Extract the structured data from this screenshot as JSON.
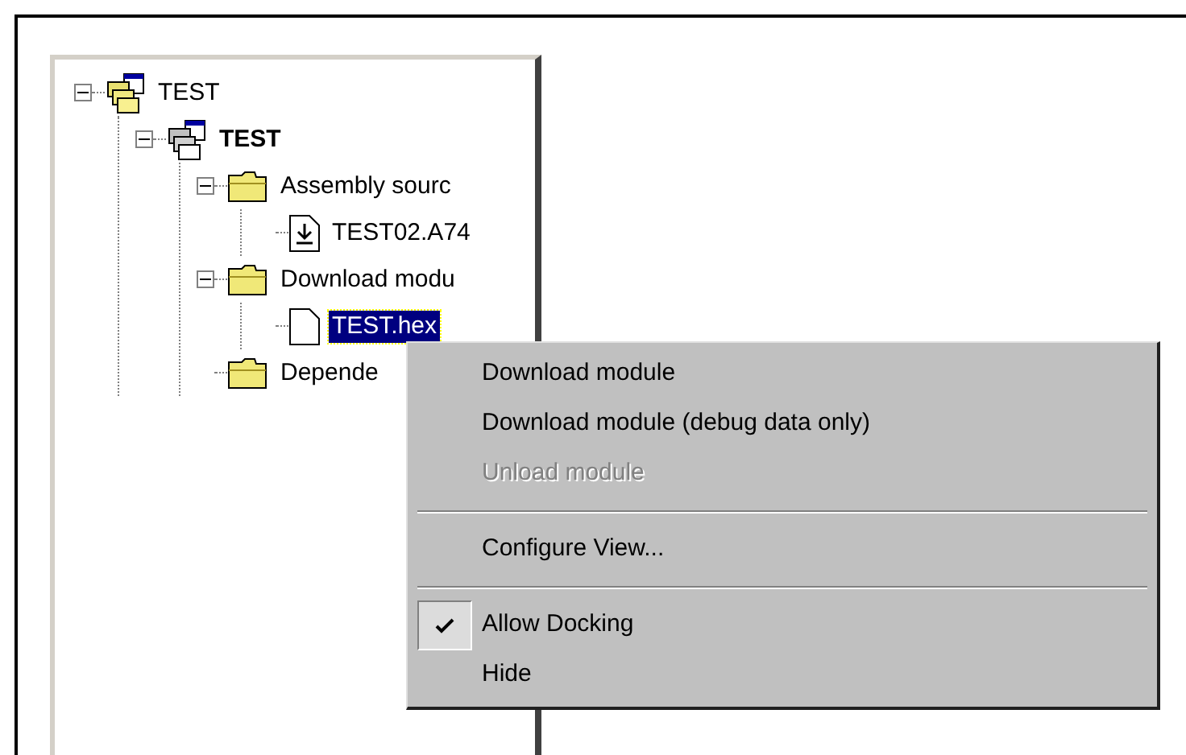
{
  "tree": [
    {
      "label": "TEST",
      "kind": "workspace",
      "expanded": true,
      "selected": false,
      "children": [
        {
          "label": "TEST",
          "kind": "project",
          "expanded": true,
          "selected": false,
          "children": [
            {
              "label": "Assembly sourc",
              "kind": "folder",
              "expanded": true,
              "selected": false,
              "children": [
                {
                  "label": "TEST02.A74",
                  "kind": "source",
                  "selected": false
                }
              ]
            },
            {
              "label": "Download modu",
              "kind": "folder",
              "expanded": true,
              "selected": false,
              "children": [
                {
                  "label": "TEST.hex",
                  "kind": "file",
                  "selected": true
                }
              ]
            },
            {
              "label": "Depende",
              "kind": "folder",
              "selected": false
            }
          ]
        }
      ]
    }
  ],
  "context_menu": [
    {
      "kind": "item",
      "label": "Download module",
      "disabled": false,
      "checked": false
    },
    {
      "kind": "item",
      "label": "Download module (debug data only)",
      "disabled": false,
      "checked": false
    },
    {
      "kind": "item",
      "label": "Unload module",
      "disabled": true,
      "checked": false
    },
    {
      "kind": "separator"
    },
    {
      "kind": "item",
      "label": "Configure View...",
      "disabled": false,
      "checked": false
    },
    {
      "kind": "separator"
    },
    {
      "kind": "item",
      "label": "Allow Docking",
      "disabled": false,
      "checked": true
    },
    {
      "kind": "item",
      "label": "Hide",
      "disabled": false,
      "checked": false
    }
  ]
}
